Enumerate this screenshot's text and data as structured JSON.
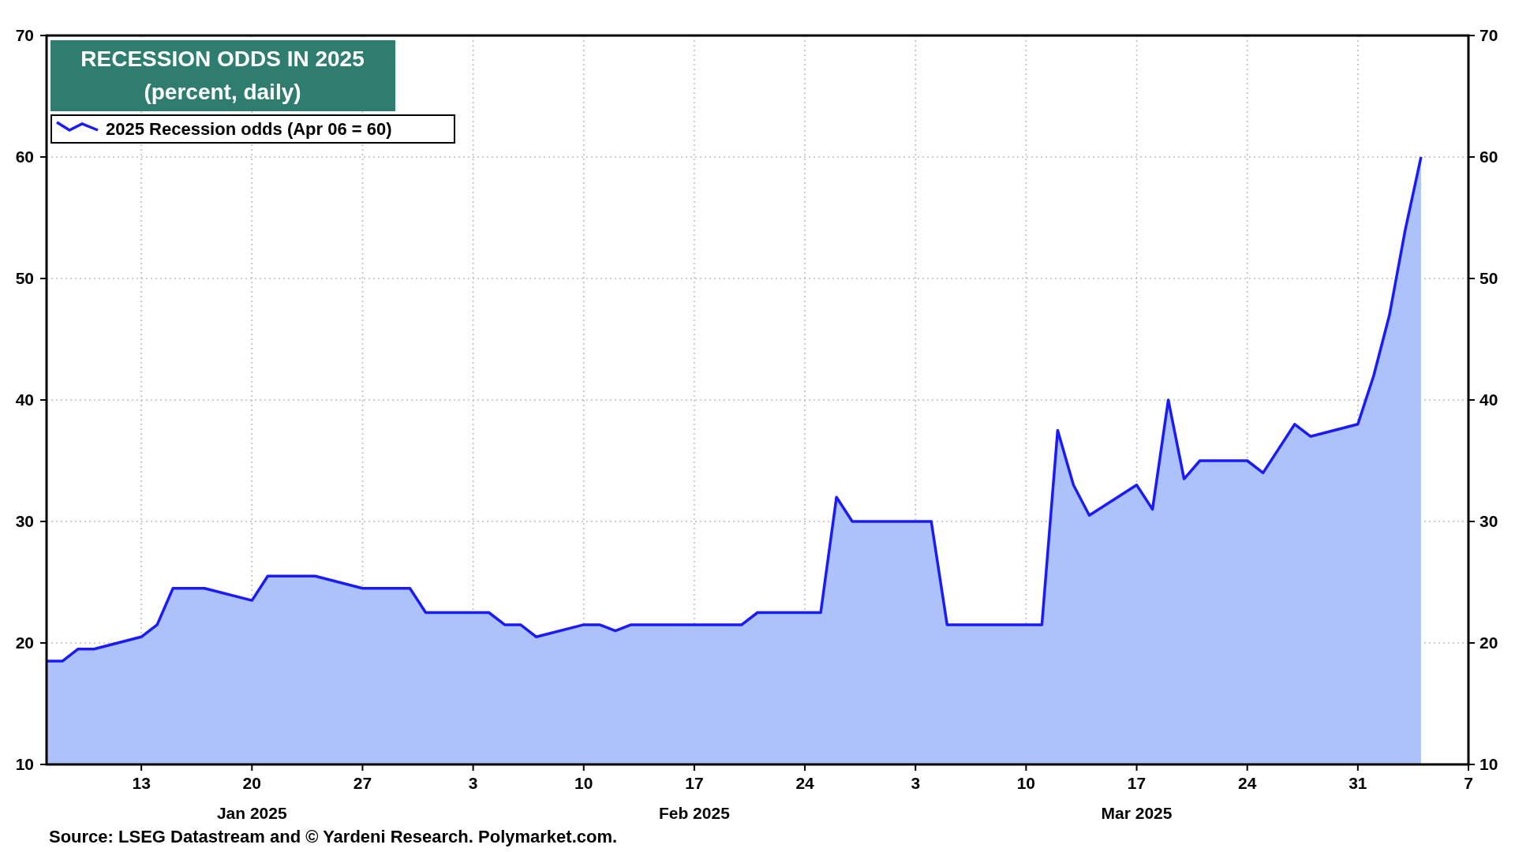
{
  "chart": {
    "title_lines": [
      "RECESSION ODDS IN 2025",
      "(percent, daily)"
    ],
    "chart_data": {
      "type": "area",
      "grid": true,
      "x": [
        "2025-01-07",
        "2025-01-08",
        "2025-01-09",
        "2025-01-10",
        "2025-01-13",
        "2025-01-14",
        "2025-01-15",
        "2025-01-16",
        "2025-01-17",
        "2025-01-20",
        "2025-01-21",
        "2025-01-22",
        "2025-01-23",
        "2025-01-24",
        "2025-01-27",
        "2025-01-28",
        "2025-01-29",
        "2025-01-30",
        "2025-01-31",
        "2025-02-03",
        "2025-02-04",
        "2025-02-05",
        "2025-02-06",
        "2025-02-07",
        "2025-02-10",
        "2025-02-11",
        "2025-02-12",
        "2025-02-13",
        "2025-02-14",
        "2025-02-17",
        "2025-02-18",
        "2025-02-19",
        "2025-02-20",
        "2025-02-21",
        "2025-02-24",
        "2025-02-25",
        "2025-02-26",
        "2025-02-27",
        "2025-02-28",
        "2025-03-03",
        "2025-03-04",
        "2025-03-05",
        "2025-03-06",
        "2025-03-07",
        "2025-03-10",
        "2025-03-11",
        "2025-03-12",
        "2025-03-13",
        "2025-03-14",
        "2025-03-17",
        "2025-03-18",
        "2025-03-19",
        "2025-03-20",
        "2025-03-21",
        "2025-03-24",
        "2025-03-25",
        "2025-03-26",
        "2025-03-27",
        "2025-03-28",
        "2025-03-31",
        "2025-04-01",
        "2025-04-02",
        "2025-04-03",
        "2025-04-04"
      ],
      "series": [
        {
          "name": "2025 Recession odds (Apr 06 = 60)",
          "color": "#1a1aff",
          "values": [
            18.5,
            18.5,
            19.5,
            19.5,
            20.5,
            21.5,
            24.5,
            24.5,
            24.5,
            23.5,
            25.5,
            25.5,
            25.5,
            25.5,
            24.5,
            24.5,
            24.5,
            24.5,
            22.5,
            22.5,
            22.5,
            21.5,
            21.5,
            20.5,
            21.5,
            21.5,
            21,
            21.5,
            21.5,
            21.5,
            21.5,
            21.5,
            21.5,
            22.5,
            22.5,
            22.5,
            32,
            30,
            30,
            30,
            30,
            21.5,
            21.5,
            21.5,
            21.5,
            21.5,
            37.5,
            33,
            30.5,
            33,
            31,
            40,
            33.5,
            35,
            35,
            34,
            36,
            38,
            37,
            38,
            42,
            47,
            54,
            60
          ]
        }
      ],
      "xlim": [
        "2025-01-07",
        "2025-04-07"
      ],
      "ylim": [
        10,
        70
      ],
      "xticks": [
        {
          "value": "2025-01-13",
          "label": "13"
        },
        {
          "value": "2025-01-20",
          "label": "20"
        },
        {
          "value": "2025-01-27",
          "label": "27"
        },
        {
          "value": "2025-02-03",
          "label": "3"
        },
        {
          "value": "2025-02-10",
          "label": "10"
        },
        {
          "value": "2025-02-17",
          "label": "17"
        },
        {
          "value": "2025-02-24",
          "label": "24"
        },
        {
          "value": "2025-03-03",
          "label": "3"
        },
        {
          "value": "2025-03-10",
          "label": "10"
        },
        {
          "value": "2025-03-17",
          "label": "17"
        },
        {
          "value": "2025-03-24",
          "label": "24"
        },
        {
          "value": "2025-03-31",
          "label": "31"
        },
        {
          "value": "2025-04-07",
          "label": "7"
        }
      ],
      "yticks": [
        10,
        20,
        30,
        40,
        50,
        60,
        70
      ]
    },
    "left_axis_labels": [
      "70",
      "60",
      "50",
      "40",
      "30",
      "20",
      "10"
    ],
    "right_axis_labels": [
      "70",
      "60",
      "50",
      "40",
      "30",
      "20",
      "10"
    ],
    "month_labels": [
      "Jan 2025",
      "Feb 2025",
      "Mar 2025"
    ]
  },
  "source": "Source: LSEG Datastream and © Yardeni Research. Polymarket.com."
}
